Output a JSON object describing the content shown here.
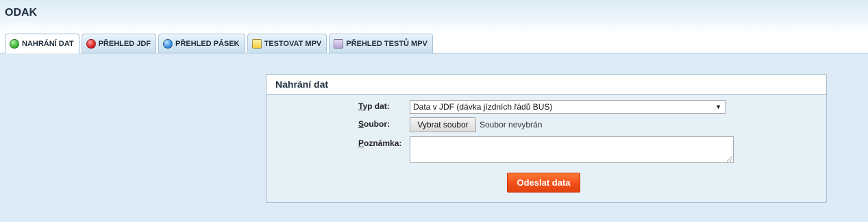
{
  "app": {
    "title": "ODAK"
  },
  "tabs": [
    {
      "label": "NAHRÁNÍ DAT",
      "icon": "green-circle-icon",
      "color": "#3fb93a",
      "active": true
    },
    {
      "label": "PŘEHLED JDF",
      "icon": "red-circle-icon",
      "color": "#e0262b",
      "active": false
    },
    {
      "label": "PŘEHLED PÁSEK",
      "icon": "blue-circle-icon",
      "color": "#3f95e6",
      "active": false
    },
    {
      "label": "TESTOVAT MPV",
      "icon": "yellow-square-icon",
      "color": "#f4cc3e",
      "active": false
    },
    {
      "label": "PŘEHLED TESTŮ MPV",
      "icon": "purple-square-icon",
      "color": "#b8a4d6",
      "active": false
    }
  ],
  "panel": {
    "title": "Nahrání dat",
    "type_label_first": "T",
    "type_label_rest": "yp dat:",
    "type_value": "Data v JDF (dávka jízdních řádů BUS)",
    "file_label_first": "S",
    "file_label_rest": "oubor:",
    "file_button": "Vybrat soubor",
    "file_status": "Soubor nevybrán",
    "note_label_first": "P",
    "note_label_rest": "oznámka:",
    "note_value": "",
    "submit_label": "Odeslat data"
  },
  "colors": {
    "accent": "#f3501a",
    "content_bg": "#dcebf5",
    "tab_border": "#a9c4da"
  }
}
